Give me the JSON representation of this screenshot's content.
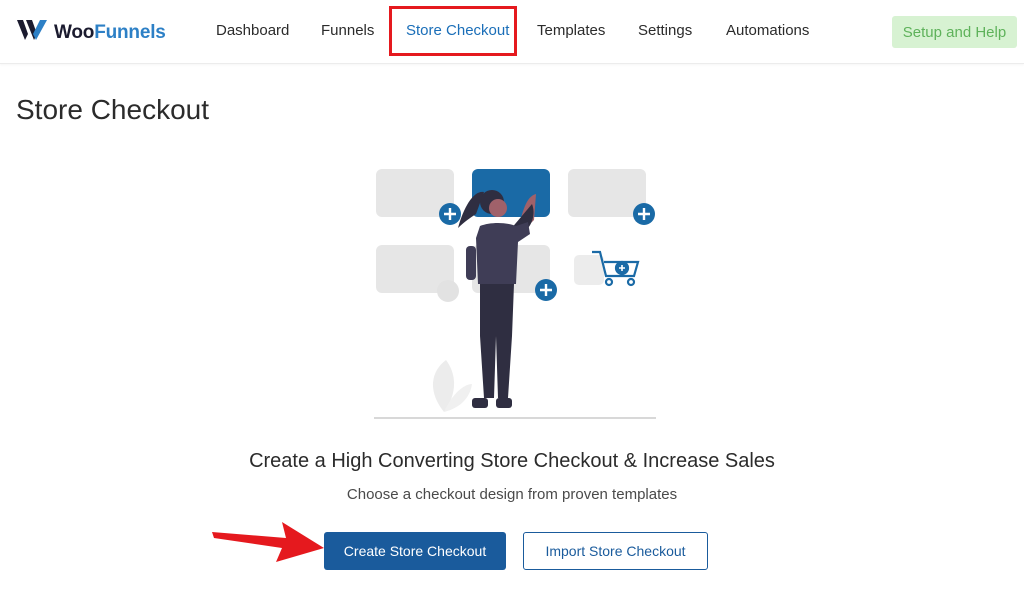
{
  "app": {
    "logo_woo": "Woo",
    "logo_funnels": "Funnels"
  },
  "nav": {
    "items": [
      {
        "label": "Dashboard"
      },
      {
        "label": "Funnels"
      },
      {
        "label": "Store Checkout"
      },
      {
        "label": "Templates"
      },
      {
        "label": "Settings"
      },
      {
        "label": "Automations"
      }
    ],
    "active": "Store Checkout",
    "setup_label": "Setup and Help"
  },
  "page": {
    "title": "Store Checkout",
    "headline": "Create a High Converting Store Checkout & Increase Sales",
    "subline": "Choose a checkout design from proven templates",
    "primary_label": "Create Store Checkout",
    "secondary_label": "Import Store Checkout"
  },
  "colors": {
    "accent": "#1a5b9c",
    "brand_blue": "#2d80c6",
    "highlight_red": "#e5191e",
    "setup_bg": "#d7f2d2",
    "setup_text": "#5eb25a"
  },
  "icons": [
    "woofunnels-logo-icon",
    "plus-circle-icon",
    "cart-icon",
    "red-arrow-annotation"
  ]
}
